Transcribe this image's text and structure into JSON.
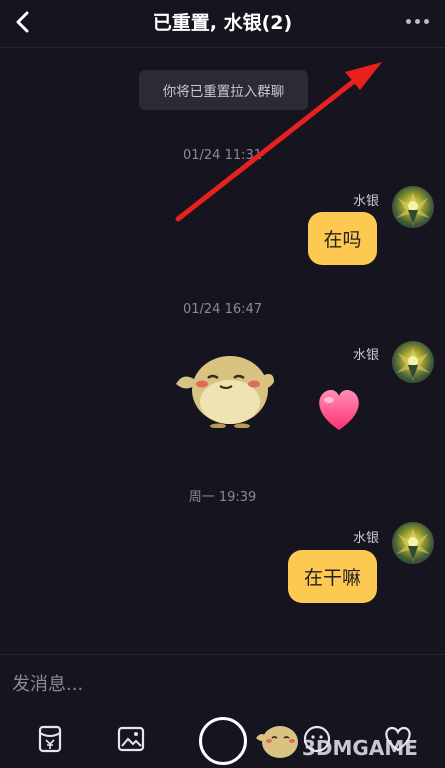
{
  "header": {
    "title": "已重置, 水银(2)",
    "back_icon": "chevron-left-icon",
    "more_icon": "more-dots-icon"
  },
  "system_note": "你将已重置拉入群聊",
  "messages": [
    {
      "time": "01/24 11:31",
      "sender": "水银",
      "text": "在吗"
    },
    {
      "time": "01/24 16:47",
      "sender": "水银",
      "stickers": [
        "duck-sticker",
        "heart-sticker"
      ]
    },
    {
      "time": "周一 19:39",
      "sender": "水银",
      "text": "在干嘛"
    }
  ],
  "input": {
    "placeholder": "发消息..."
  },
  "toolbar": [
    "red-packet-icon",
    "image-icon",
    "record-button",
    "sticker-icon",
    "emoji-icon",
    "heart-icon"
  ],
  "watermark": "3DMGAME",
  "colors": {
    "background": "#16151f",
    "bubble": "#fdc951",
    "annotation_arrow": "#e8201e"
  }
}
